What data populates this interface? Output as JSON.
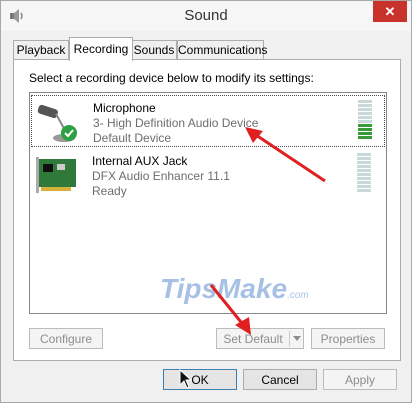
{
  "window": {
    "title": "Sound",
    "close_label": "✕"
  },
  "tabs": [
    {
      "label": "Playback",
      "active": false
    },
    {
      "label": "Recording",
      "active": true
    },
    {
      "label": "Sounds",
      "active": false
    },
    {
      "label": "Communications",
      "active": false
    }
  ],
  "panel": {
    "instruction": "Select a recording device below to modify its settings:",
    "devices": [
      {
        "name": "Microphone",
        "subtitle": "3- High Definition Audio Device",
        "status": "Default Device",
        "icon": "microphone-icon",
        "default_check": true,
        "selected": true,
        "level": 0.35
      },
      {
        "name": "Internal AUX Jack",
        "subtitle": "DFX Audio Enhancer 11.1",
        "status": "Ready",
        "icon": "sound-card-icon",
        "default_check": false,
        "selected": false,
        "level": 0
      }
    ],
    "configure_label": "Configure",
    "set_default_label": "Set Default",
    "properties_label": "Properties"
  },
  "footer": {
    "ok_label": "OK",
    "cancel_label": "Cancel",
    "apply_label": "Apply"
  },
  "watermark": {
    "text": "TipsMake",
    "suffix": ".com"
  },
  "colors": {
    "close": "#c7322b",
    "meter_on": "#3a9a3a",
    "meter_off": "#c9d9d9",
    "arrow": "#e02020",
    "watermark": "#5f8fd0"
  }
}
